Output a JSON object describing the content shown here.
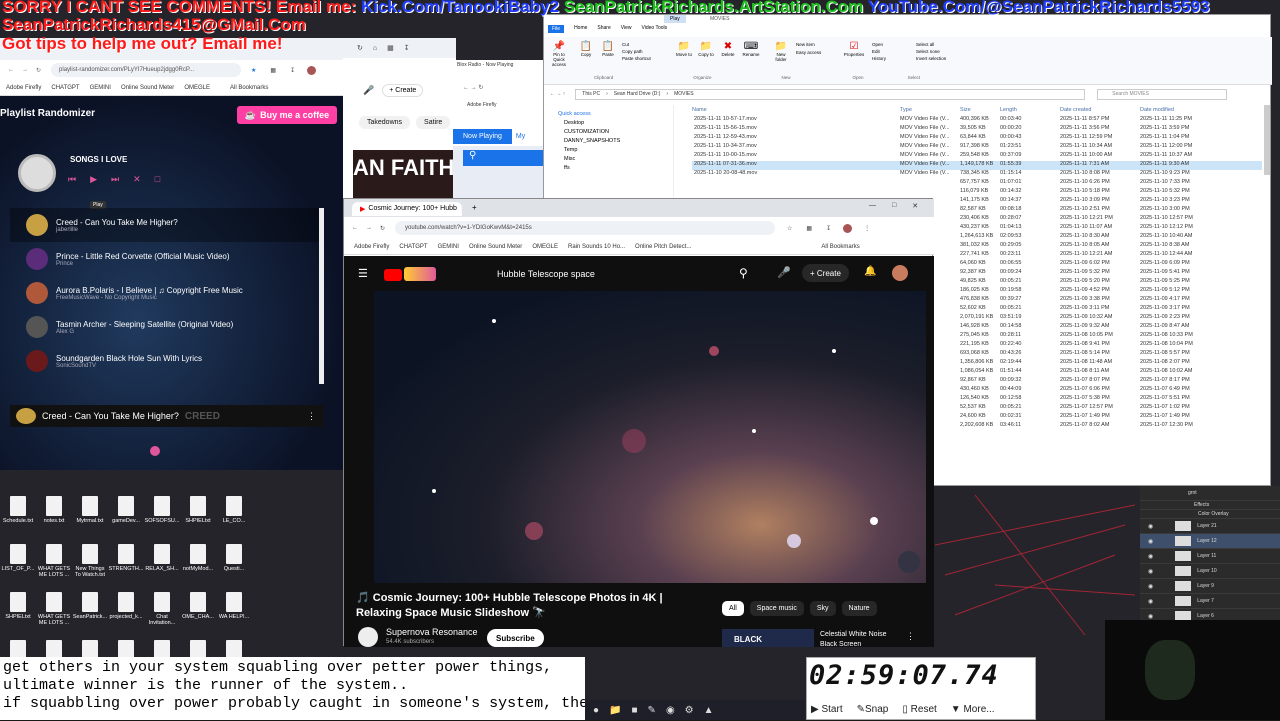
{
  "overlay": {
    "line1_left": "SORRY I CANT SEE COMMENTS! Email me:",
    "line1_kick": "Kick.Com/TanookiBaby2",
    "line1_art": "SeanPatrickRichards.ArtStation.Com",
    "line1_yt": "YouTube.Com/@SeanPatrickRichards5593",
    "line2": "SeanPatrickRichards415@GMail.Com",
    "line3": "Got tips to help me out? Email me!"
  },
  "playlist": {
    "url": "playlist-randomizer.com/PLyYI7Hueup2jdgg0RcP...",
    "bookmarks": [
      "Adobe Firefly",
      "CHATGPT",
      "GEMINI",
      "Online Sound Meter",
      "OMEGLE",
      "All Bookmarks"
    ],
    "title": "Playlist Randomizer",
    "coffee": "Buy me a coffee",
    "now_title": "SONGS I LOVE",
    "tooltip": "Play",
    "songs": [
      {
        "t": "Creed - Can You Take Me Higher?",
        "a": "jaberlille"
      },
      {
        "t": "Prince - Little Red Corvette (Official Music Video)",
        "a": "Prince"
      },
      {
        "t": "Aurora B.Polaris - I Believe | ♫ Copyright Free Music",
        "a": "FreeMusicWave - No Copyright Music"
      },
      {
        "t": "Tasmin Archer - Sleeping Satellite (Original Video)",
        "a": "Alex G"
      },
      {
        "t": "Soundgarden Black Hole Sun With Lyrics",
        "a": "SonicSoundTV"
      }
    ],
    "player_title": "Creed - Can You Take Me Higher?",
    "player_overlay": "CREED"
  },
  "yt_small": {
    "create": "Create",
    "chips": [
      "Takedowns",
      "Satire"
    ],
    "banner": "AN FAITH"
  },
  "blox": {
    "tab": "Blox Radio - Now Playing",
    "bm": "Adobe Firefly",
    "now_playing": "Now Playing",
    "my": "My"
  },
  "explorer": {
    "ribbon_tabs": [
      "File",
      "Home",
      "Share",
      "View",
      "Video Tools"
    ],
    "play_tab": "Play",
    "movies_tab": "MOVIES",
    "groups": [
      "Clipboard",
      "Organize",
      "New",
      "Open",
      "Select"
    ],
    "btns": [
      "Pin to Quick access",
      "Copy",
      "Paste",
      "Cut",
      "Copy path",
      "Paste shortcut",
      "Move to",
      "Copy to",
      "Delete",
      "Rename",
      "New folder",
      "New item",
      "Easy access",
      "Properties",
      "Open",
      "Edit",
      "History",
      "Select all",
      "Select none",
      "Invert selection"
    ],
    "breadcrumb": [
      "This PC",
      "Sean Hard Drive (D:)",
      "MOVIES"
    ],
    "search": "Search MOVIES",
    "nav": [
      "Quick access",
      "Desktop",
      "CUSTOMIZATION",
      "DANNY_SNAPSHOTS",
      "Temp",
      "Misc",
      "ffs"
    ],
    "cols": [
      "Name",
      "Type",
      "Size",
      "Length",
      "Date created",
      "Date modified"
    ],
    "files": [
      {
        "n": "2025-11-11 10-57-17.mov",
        "ty": "MOV Video File (V...",
        "s": "400,396 KB",
        "l": "00:03:40",
        "c": "2025-11-11 8:57 PM",
        "m": "2025-11-11 11:25 PM"
      },
      {
        "n": "2025-11-11 15-56-15.mov",
        "ty": "MOV Video File (V...",
        "s": "39,505 KB",
        "l": "00:00:20",
        "c": "2025-11-11 3:56 PM",
        "m": "2025-11-11 3:59 PM"
      },
      {
        "n": "2025-11-11 12-59-43.mov",
        "ty": "MOV Video File (V...",
        "s": "63,844 KB",
        "l": "00:00:43",
        "c": "2025-11-11 12:59 PM",
        "m": "2025-11-11 1:04 PM"
      },
      {
        "n": "2025-11-11 10-34-37.mov",
        "ty": "MOV Video File (V...",
        "s": "917,398 KB",
        "l": "01:23:51",
        "c": "2025-11-11 10:34 AM",
        "m": "2025-11-11 12:00 PM"
      },
      {
        "n": "2025-11-11 10-00-15.mov",
        "ty": "MOV Video File (V...",
        "s": "259,548 KB",
        "l": "00:37:09",
        "c": "2025-11-11 10:00 AM",
        "m": "2025-11-11 10:37 AM"
      },
      {
        "n": "2025-11-11 07-31-36.mov",
        "ty": "MOV Video File (V...",
        "s": "1,149,178 KB",
        "l": "01:55:39",
        "c": "2025-11-11 7:31 AM",
        "m": "2025-11-11 9:30 AM"
      },
      {
        "n": "2025-11-10 20-08-48.mov",
        "ty": "MOV Video File (V...",
        "s": "738,345 KB",
        "l": "01:15:14",
        "c": "2025-11-10 8:08 PM",
        "m": "2025-11-10 9:23 PM"
      }
    ],
    "more_rows": [
      [
        "657,757 KB",
        "01:07:01",
        "2025-11-10 6:26 PM",
        "2025-11-10 7:33 PM"
      ],
      [
        "116,079 KB",
        "00:14:32",
        "2025-11-10 5:18 PM",
        "2025-11-10 5:32 PM"
      ],
      [
        "141,175 KB",
        "00:14:37",
        "2025-11-10 3:09 PM",
        "2025-11-10 3:23 PM"
      ],
      [
        "82,587 KB",
        "00:08:18",
        "2025-11-10 2:51 PM",
        "2025-11-10 3:00 PM"
      ],
      [
        "230,406 KB",
        "00:28:07",
        "2025-11-10 12:21 PM",
        "2025-11-10 12:57 PM"
      ],
      [
        "430,237 KB",
        "01:04:13",
        "2025-11-10 11:07 AM",
        "2025-11-10 12:12 PM"
      ],
      [
        "1,264,613 KB",
        "02:09:53",
        "2025-11-10 8:30 AM",
        "2025-11-10 10:40 AM"
      ],
      [
        "381,032 KB",
        "00:29:05",
        "2025-11-10 8:05 AM",
        "2025-11-10 8:38 AM"
      ],
      [
        "227,741 KB",
        "00:23:11",
        "2025-11-10 12:21 AM",
        "2025-11-10 12:44 AM"
      ],
      [
        "64,060 KB",
        "00:06:55",
        "2025-11-09 6:02 PM",
        "2025-11-09 6:09 PM"
      ],
      [
        "92,387 KB",
        "00:09:24",
        "2025-11-09 5:32 PM",
        "2025-11-09 5:41 PM"
      ],
      [
        "49,825 KB",
        "00:05:21",
        "2025-11-09 5:20 PM",
        "2025-11-09 5:25 PM"
      ],
      [
        "186,025 KB",
        "00:19:58",
        "2025-11-09 4:52 PM",
        "2025-11-09 5:12 PM"
      ],
      [
        "476,838 KB",
        "00:39:27",
        "2025-11-09 3:38 PM",
        "2025-11-09 4:17 PM"
      ],
      [
        "52,602 KB",
        "00:05:21",
        "2025-11-09 3:11 PM",
        "2025-11-09 3:17 PM"
      ],
      [
        "2,070,191 KB",
        "03:51:19",
        "2025-11-09 10:32 AM",
        "2025-11-09 2:23 PM"
      ],
      [
        "146,928 KB",
        "00:14:58",
        "2025-11-09 9:32 AM",
        "2025-11-09 8:47 AM"
      ],
      [
        "275,045 KB",
        "00:28:11",
        "2025-11-08 10:05 PM",
        "2025-11-08 10:33 PM"
      ],
      [
        "221,195 KB",
        "00:22:40",
        "2025-11-08 9:41 PM",
        "2025-11-08 10:04 PM"
      ],
      [
        "693,068 KB",
        "00:43:26",
        "2025-11-08 5:14 PM",
        "2025-11-08 5:57 PM"
      ],
      [
        "1,356,806 KB",
        "02:19:44",
        "2025-11-08 11:48 AM",
        "2025-11-08 2:07 PM"
      ],
      [
        "1,086,054 KB",
        "01:51:44",
        "2025-11-08 8:11 AM",
        "2025-11-08 10:02 AM"
      ],
      [
        "92,867 KB",
        "00:09:32",
        "2025-11-07 8:07 PM",
        "2025-11-07 8:17 PM"
      ],
      [
        "430,460 KB",
        "00:44:09",
        "2025-11-07 6:06 PM",
        "2025-11-07 6:49 PM"
      ],
      [
        "126,540 KB",
        "00:12:58",
        "2025-11-07 5:38 PM",
        "2025-11-07 5:51 PM"
      ],
      [
        "52,537 KB",
        "00:05:21",
        "2025-11-07 12:57 PM",
        "2025-11-07 1:02 PM"
      ],
      [
        "24,600 KB",
        "00:02:31",
        "2025-11-07 1:49 PM",
        "2025-11-07 1:49 PM"
      ],
      [
        "2,202,608 KB",
        "03:46:11",
        "2025-11-07 8:02 AM",
        "2025-11-07 12:30 PM"
      ]
    ]
  },
  "youtube": {
    "tab": "Cosmic Journey: 100+ Hubb",
    "url": "youtube.com/watch?v=1-YDIGoKwvM&t=2415s",
    "bookmarks": [
      "Adobe Firefly",
      "CHATGPT",
      "GEMINI",
      "Online Sound Meter",
      "OMEGLE",
      "Rain Sounds 10 Ho...",
      "Online Pitch Detect...",
      "All Bookmarks"
    ],
    "search": "Hubble Telescope space",
    "create": "Create",
    "video_title": "🎵 Cosmic Journey: 100+ Hubble Telescope Photos in 4K | Relaxing Space Music Slideshow 🔭",
    "channel": "Supernova Resonance",
    "subs": "54.4K subscribers",
    "subscribe": "Subscribe",
    "chips": [
      "All",
      "Space music",
      "Sky",
      "Nature"
    ],
    "rec_title": "Celestial White Noise",
    "rec_sub": "Black Screen",
    "rec_badge": "BLACK"
  },
  "desktop_files": [
    [
      "Schedule.txt",
      "notes.txt",
      "Mytrmal.txt",
      "gameDev...",
      "SOFSOFSU...",
      "SHPIELtxt",
      "LE_CO..."
    ],
    [
      "LIST_OF_P...",
      "WHAT GETS ME LOTS ...",
      "New Things To Watch.txt",
      "STRENGTH...",
      "RELAX_SH...",
      "notMyMod...",
      "Questi..."
    ],
    [
      "SHPIELtxt",
      "WHAT GETS ME LOTS ...",
      "SeanPatrick...",
      "projected_k...",
      "Chat Invitation...",
      "OME_CHA...",
      "WA HELPI..."
    ],
    [
      "Click_Bait_...",
      "20210315_t...",
      "more copied to Energy a...",
      "new mantra.txt",
      "JIU JITSU_MY BREAD AN...",
      "OME_CHA...",
      "SCHE TODOS"
    ]
  ],
  "ticker": {
    "l1": "get others in your system squabling over petter power things,",
    "l2": "ultimate winner is the runner of the system..",
    "l3": "if squabbling over power probably caught in someone's system, the"
  },
  "timer": {
    "time": "02:59:07.74",
    "start": "Start",
    "snap": "Snap",
    "reset": "Reset",
    "more": "More..."
  },
  "layers": {
    "group": "grnt",
    "effects": "Effects",
    "overlay": "Color Overlay",
    "items": [
      "Layer 21",
      "Layer 12",
      "Layer 11",
      "Layer 10",
      "Layer 9",
      "Layer 7",
      "Layer 6"
    ]
  },
  "colors": {
    "overlay_red": "#ff1a1a",
    "overlay_blue": "#1e3cff",
    "overlay_green": "#19c019",
    "yt_red": "#ff0000",
    "coffee": "#ff3fa4"
  }
}
